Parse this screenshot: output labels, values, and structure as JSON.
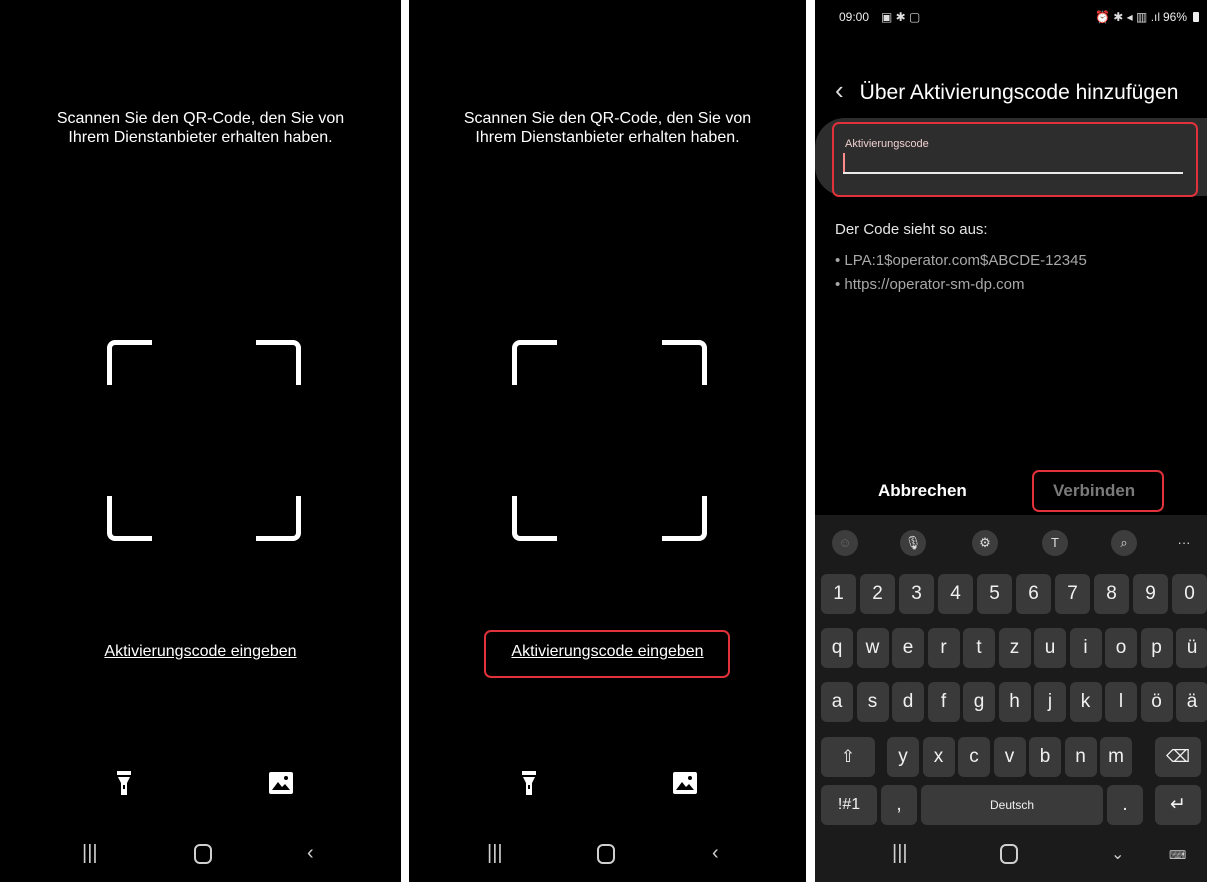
{
  "scan_panels": [
    {
      "instruction": "Scannen Sie den QR-Code, den Sie von Ihrem Dienstanbieter erhalten haben.",
      "link": "Aktivierungscode eingeben",
      "highlighted": false
    },
    {
      "instruction": "Scannen Sie den QR-Code, den Sie von Ihrem Dienstanbieter erhalten haben.",
      "link": "Aktivierungscode eingeben",
      "highlighted": true
    }
  ],
  "icons": {
    "flashlight": "flashlight-icon",
    "gallery": "gallery-icon",
    "nav_recents": "recents-icon",
    "nav_home": "home-icon",
    "nav_back": "back-icon"
  },
  "activation": {
    "status_time": "09:00",
    "status_right": "96%",
    "title": "Über Aktivierungscode hinzufügen",
    "field_label": "Aktivierungscode",
    "code_heading": "Der Code sieht so aus:",
    "examples": [
      "• LPA:1$operator.com$ABCDE-12345",
      "• https://operator-sm-dp.com"
    ],
    "cancel": "Abbrechen",
    "connect": "Verbinden"
  },
  "keyboard": {
    "row_numbers": [
      "1",
      "2",
      "3",
      "4",
      "5",
      "6",
      "7",
      "8",
      "9",
      "0"
    ],
    "row1": [
      "q",
      "w",
      "e",
      "r",
      "t",
      "z",
      "u",
      "i",
      "o",
      "p",
      "ü"
    ],
    "row2": [
      "a",
      "s",
      "d",
      "f",
      "g",
      "h",
      "j",
      "k",
      "l",
      "ö",
      "ä"
    ],
    "row3": [
      "y",
      "x",
      "c",
      "v",
      "b",
      "n",
      "m"
    ],
    "symbols": "!#1",
    "comma": ",",
    "space": "Deutsch",
    "period": "."
  },
  "colors": {
    "highlight": "#e0323b",
    "background": "#000000",
    "keyboard_bg": "#1b1b1b",
    "key": "#3a3a3a"
  }
}
